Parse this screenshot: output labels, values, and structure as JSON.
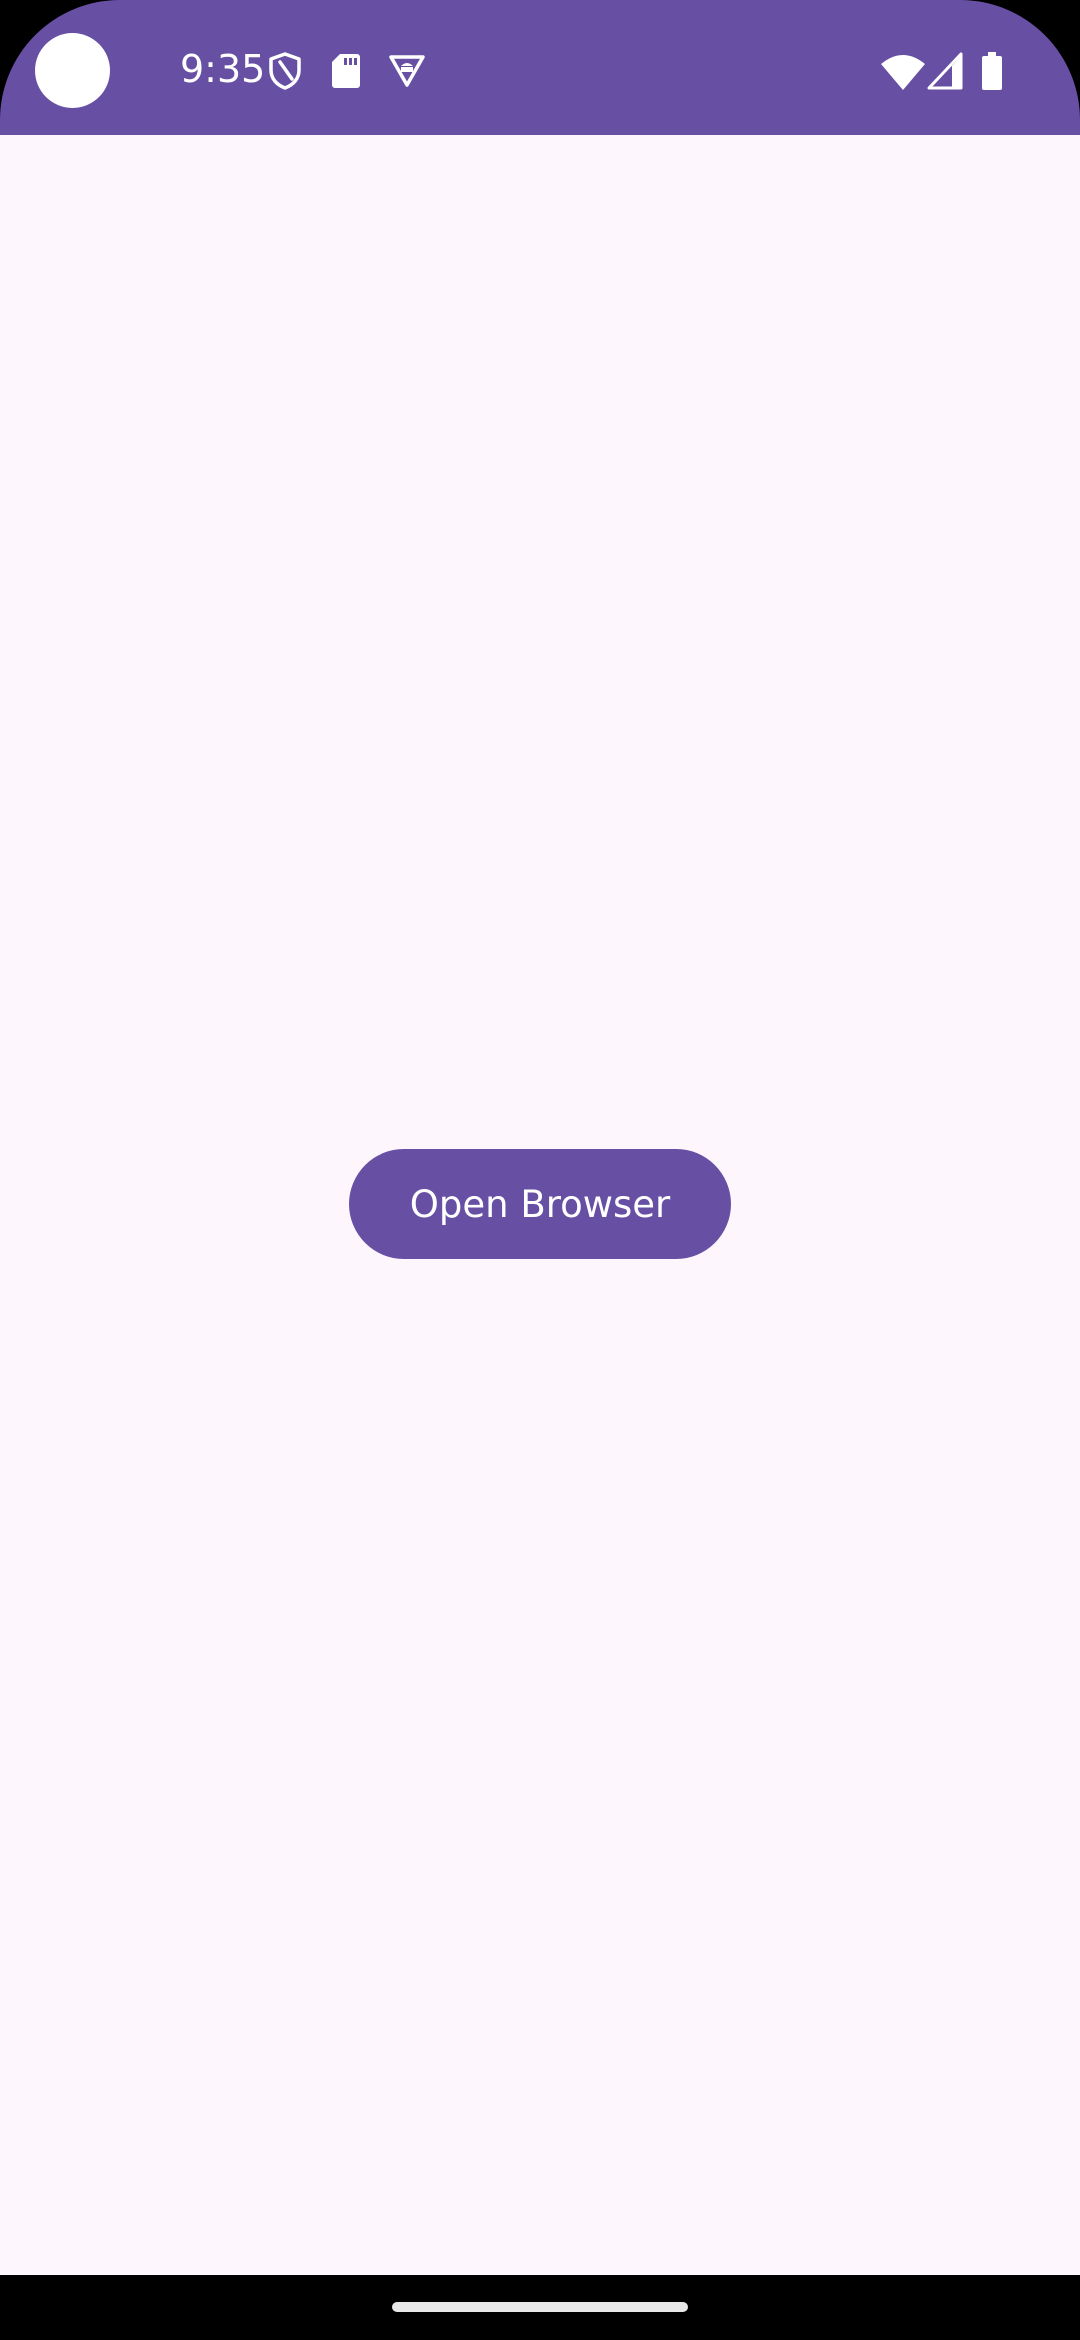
{
  "status_bar": {
    "time": "9:35",
    "background_color": "#6750A4",
    "left_icons": [
      "shield-icon",
      "sd-card-icon",
      "vpn-icon"
    ],
    "right_icons": [
      "wifi-icon",
      "signal-icon",
      "battery-icon"
    ]
  },
  "main": {
    "background_color": "#FDF6FD",
    "open_browser_label": "Open Browser",
    "button_color": "#6750A4"
  }
}
